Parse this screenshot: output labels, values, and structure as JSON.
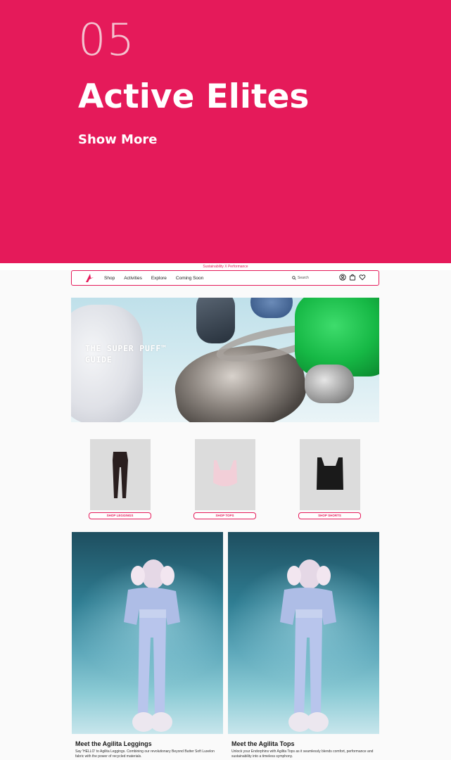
{
  "hero": {
    "number": "05",
    "title": "Active Elites",
    "show_more": "Show More",
    "bg_color": "#e51a5a"
  },
  "site": {
    "promo_text": "Sustainability X Performance",
    "accent_color": "#e51a5a",
    "nav": {
      "logo_icon": "agilita-logo-icon",
      "links": [
        "Shop",
        "Activities",
        "Explore",
        "Coming Soon"
      ],
      "search_placeholder": "Search",
      "icons": [
        "account-icon",
        "bag-icon",
        "heart-icon"
      ]
    },
    "banner": {
      "title": "THE SUPER PUFF™ GUIDE"
    },
    "products": [
      {
        "button": "SHOP LEGGINGS",
        "image": "black-leggings"
      },
      {
        "button": "SHOP TOPS",
        "image": "pink-sports-bra"
      },
      {
        "button": "SHOP SHORTS",
        "image": "black-tank-top"
      }
    ],
    "cards": [
      {
        "title": "Meet the Agilita Leggings",
        "text": "Say 'HELLO' to Agilita Leggings. Combining our revolutionary Beyond Butter Soft Luxelon fabric with the power of recycled materials."
      },
      {
        "title": "Meet the Agilita Tops",
        "text": "Unlock your Endorphins with Agilita Tops as it seamlessly blends comfort, performance and sustainability into a timeless symphony."
      }
    ]
  }
}
